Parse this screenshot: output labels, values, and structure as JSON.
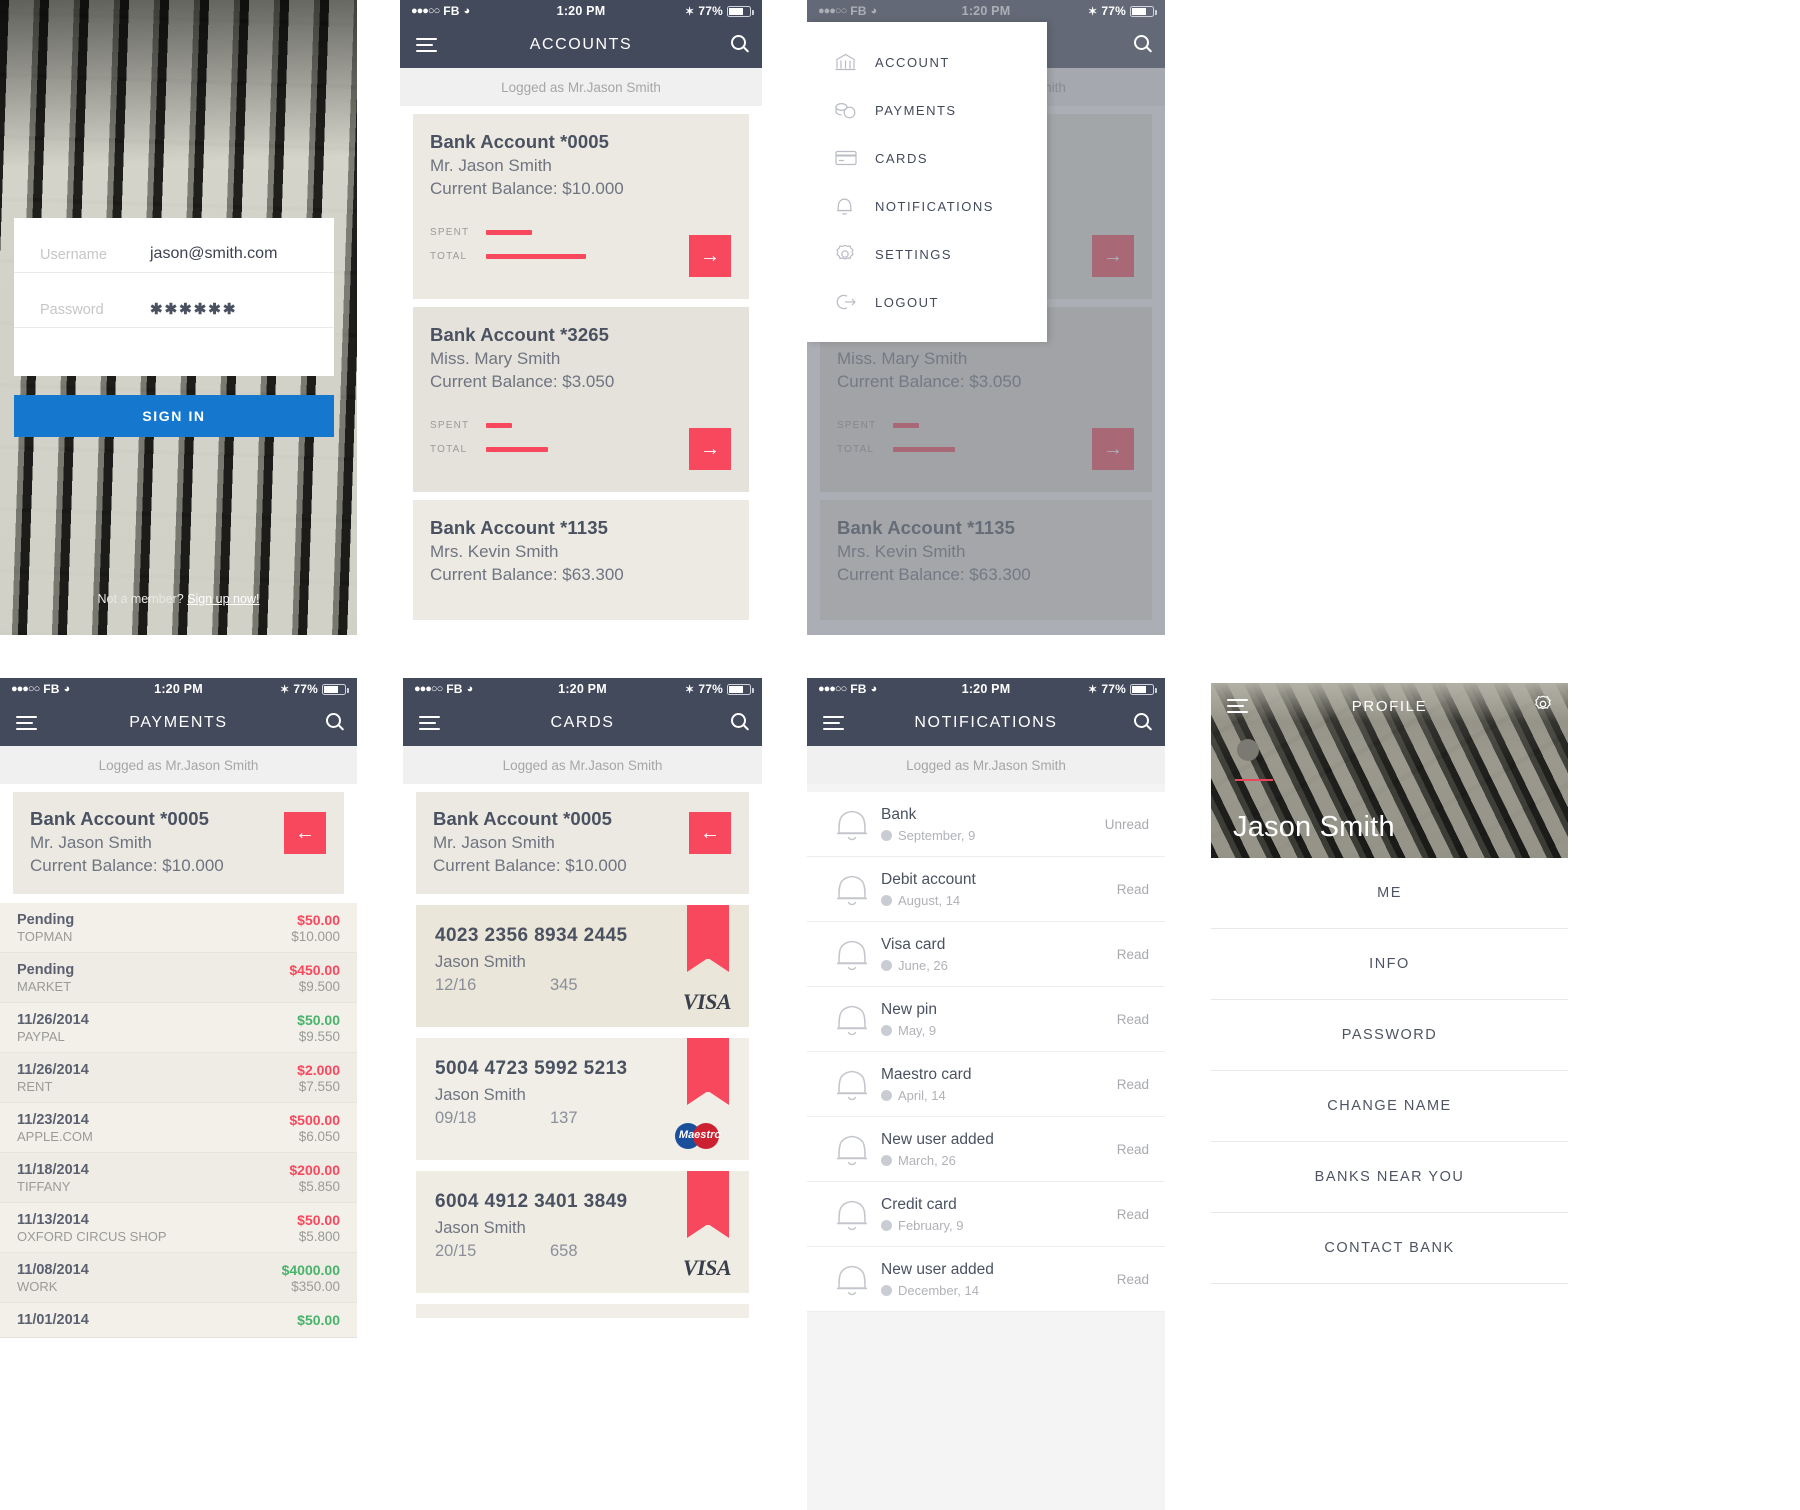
{
  "status_bar": {
    "dots": "●●●○○",
    "carrier": "FB",
    "wifi_icon": "wifi-icon",
    "time": "1:20 PM",
    "bluetooth_icon": "bluetooth-icon",
    "battery_pct": "77%"
  },
  "colors": {
    "navbar": "#434a5c",
    "accent_red": "#f8485e",
    "accent_blue": "#1578ce",
    "positive_green": "#49b36b",
    "card_bg": "#ebe9e2"
  },
  "login": {
    "username_label": "Username",
    "username_value": "jason@smith.com",
    "password_label": "Password",
    "password_value": "✱✱✱✱✱✱",
    "signin_label": "SIGN IN",
    "footer_text": "Not a member?",
    "footer_link": "Sign up now!"
  },
  "accounts_screen": {
    "title": "ACCOUNTS",
    "logged_as": "Logged as Mr.Jason Smith",
    "menu_icon": "hamburger-icon",
    "search_icon": "search-icon",
    "spent_label": "SPENT",
    "total_label": "TOTAL",
    "arrow_label": "→",
    "cards": [
      {
        "title": "Bank Account *0005",
        "owner": "Mr. Jason Smith",
        "balance": "Current Balance: $10.000",
        "spent_width": 46,
        "total_width": 100
      },
      {
        "title": "Bank Account *3265",
        "owner": "Miss. Mary Smith",
        "balance": "Current Balance: $3.050",
        "spent_width": 26,
        "total_width": 62
      },
      {
        "title": "Bank Account *1135",
        "owner": "Mrs. Kevin Smith",
        "balance": "Current Balance: $63.300",
        "spent_width": 0,
        "total_width": 0
      }
    ]
  },
  "drawer": {
    "items": [
      {
        "label": "ACCOUNT",
        "icon": "bank-icon",
        "glyph": "ἽB"
      },
      {
        "label": "PAYMENTS",
        "icon": "coins-icon",
        "glyph": "◑"
      },
      {
        "label": "CARDS",
        "icon": "credit-card-icon",
        "glyph": "▭"
      },
      {
        "label": "NOTIFICATIONS",
        "icon": "bell-icon",
        "glyph": "✩"
      },
      {
        "label": "SETTINGS",
        "icon": "gear-icon",
        "glyph": "⚙"
      },
      {
        "label": "LOGOUT",
        "icon": "logout-icon",
        "glyph": "➠"
      }
    ]
  },
  "payments_screen": {
    "title": "PAYMENTS",
    "logged_as": "Logged as Mr.Jason Smith",
    "back_arrow": "←",
    "account": {
      "title": "Bank Account *0005",
      "owner": "Mr. Jason Smith",
      "balance": "Current Balance: $10.000"
    },
    "transactions": [
      {
        "date": "Pending",
        "merchant": "TOPMAN",
        "amount": "$50.00",
        "balance": "$10.000",
        "sign": "neg"
      },
      {
        "date": "Pending",
        "merchant": "MARKET",
        "amount": "$450.00",
        "balance": "$9.500",
        "sign": "neg"
      },
      {
        "date": "11/26/2014",
        "merchant": "PAYPAL",
        "amount": "$50.00",
        "balance": "$9.550",
        "sign": "pos"
      },
      {
        "date": "11/26/2014",
        "merchant": "RENT",
        "amount": "$2.000",
        "balance": "$7.550",
        "sign": "neg"
      },
      {
        "date": "11/23/2014",
        "merchant": "APPLE.COM",
        "amount": "$500.00",
        "balance": "$6.050",
        "sign": "neg"
      },
      {
        "date": "11/18/2014",
        "merchant": "TIFFANY",
        "amount": "$200.00",
        "balance": "$5.850",
        "sign": "neg"
      },
      {
        "date": "11/13/2014",
        "merchant": "OXFORD CIRCUS SHOP",
        "amount": "$50.00",
        "balance": "$5.800",
        "sign": "neg"
      },
      {
        "date": "11/08/2014",
        "merchant": "WORK",
        "amount": "$4000.00",
        "balance": "$350.00",
        "sign": "pos"
      },
      {
        "date": "11/01/2014",
        "merchant": "",
        "amount": "$50.00",
        "balance": "",
        "sign": "pos"
      }
    ]
  },
  "cards_screen": {
    "title": "CARDS",
    "logged_as": "Logged as Mr.Jason Smith",
    "back_arrow": "←",
    "account": {
      "title": "Bank Account *0005",
      "owner": "Mr. Jason Smith",
      "balance": "Current Balance: $10.000"
    },
    "cards": [
      {
        "number": "4023 2356 8934 2445",
        "holder": "Jason Smith",
        "expiry": "12/16",
        "cvv": "345",
        "brand": "VISA"
      },
      {
        "number": "5004 4723 5992 5213",
        "holder": "Jason Smith",
        "expiry": "09/18",
        "cvv": "137",
        "brand": "Maestro"
      },
      {
        "number": "6004 4912 3401 3849",
        "holder": "Jason Smith",
        "expiry": "20/15",
        "cvv": "658",
        "brand": "VISA"
      }
    ]
  },
  "notifications_screen": {
    "title": "NOTIFICATIONS",
    "logged_as": "Logged as Mr.Jason Smith",
    "items": [
      {
        "title": "Bank",
        "date": "September, 9",
        "status": "Unread"
      },
      {
        "title": "Debit account",
        "date": "August, 14",
        "status": "Read"
      },
      {
        "title": "Visa card",
        "date": "June, 26",
        "status": "Read"
      },
      {
        "title": "New pin",
        "date": "May, 9",
        "status": "Read"
      },
      {
        "title": "Maestro card",
        "date": "April, 14",
        "status": "Read"
      },
      {
        "title": "New user added",
        "date": "March, 26",
        "status": "Read"
      },
      {
        "title": "Credit card",
        "date": "February, 9",
        "status": "Read"
      },
      {
        "title": "New user added",
        "date": "December, 14",
        "status": "Read"
      }
    ]
  },
  "profile_screen": {
    "title": "PROFILE",
    "name": "Jason Smith",
    "settings_icon": "gear-icon",
    "menu": [
      {
        "label": "ME"
      },
      {
        "label": "INFO"
      },
      {
        "label": "PASSWORD"
      },
      {
        "label": "CHANGE NAME"
      },
      {
        "label": "BANKS NEAR YOU"
      },
      {
        "label": "CONTACT BANK"
      }
    ]
  }
}
